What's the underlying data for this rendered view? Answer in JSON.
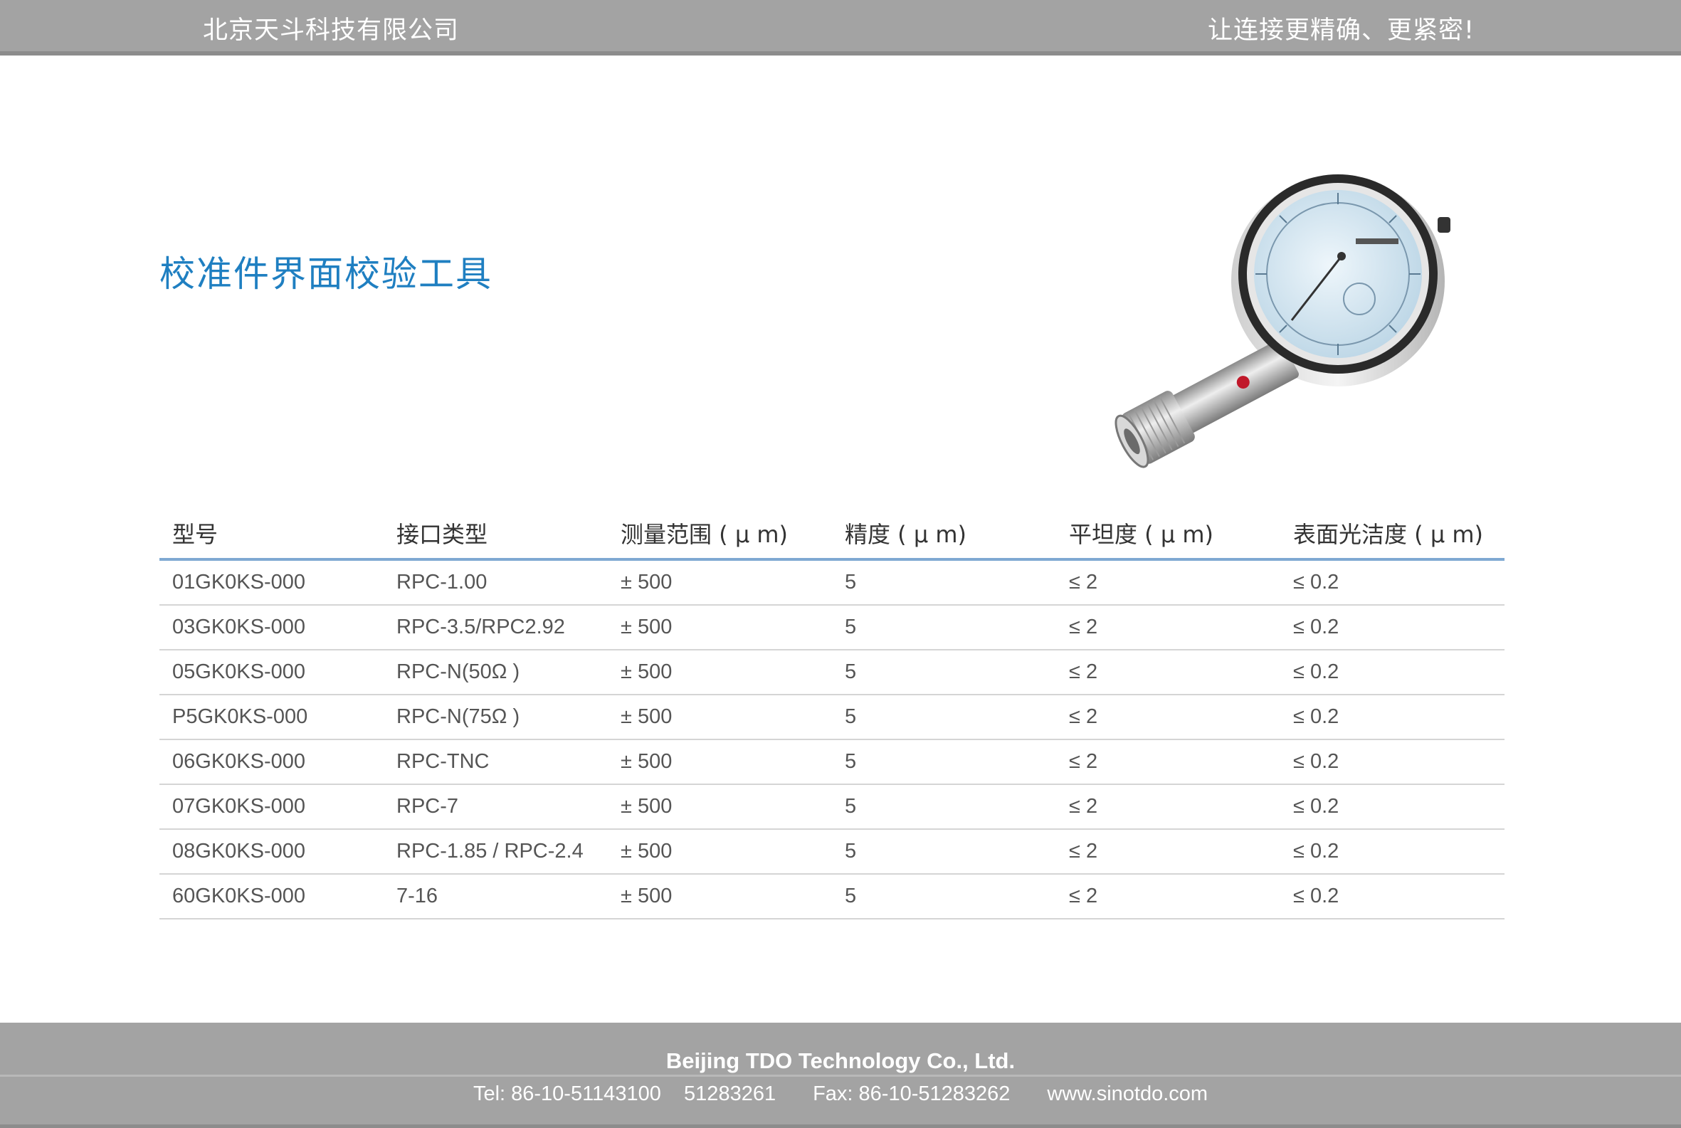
{
  "header": {
    "company": "北京天斗科技有限公司",
    "slogan": "让连接更精确、更紧密!"
  },
  "title": "校准件界面校验工具",
  "table": {
    "headers": [
      "型号",
      "接口类型",
      "测量范围 ( μ m)",
      "精度 ( μ m)",
      "平坦度 ( μ m)",
      "表面光洁度 ( μ m)"
    ],
    "rows": [
      [
        "01GK0KS-000",
        "RPC-1.00",
        "± 500",
        "5",
        "≤ 2",
        "≤ 0.2"
      ],
      [
        "03GK0KS-000",
        "RPC-3.5/RPC2.92",
        "± 500",
        "5",
        "≤ 2",
        "≤ 0.2"
      ],
      [
        "05GK0KS-000",
        "RPC-N(50Ω )",
        "± 500",
        "5",
        "≤ 2",
        "≤ 0.2"
      ],
      [
        "P5GK0KS-000",
        "RPC-N(75Ω )",
        "± 500",
        "5",
        "≤ 2",
        "≤ 0.2"
      ],
      [
        "06GK0KS-000",
        "RPC-TNC",
        "± 500",
        "5",
        "≤ 2",
        "≤ 0.2"
      ],
      [
        "07GK0KS-000",
        "RPC-7",
        "± 500",
        "5",
        "≤ 2",
        "≤ 0.2"
      ],
      [
        "08GK0KS-000",
        "RPC-1.85 / RPC-2.4",
        "± 500",
        "5",
        "≤ 2",
        "≤ 0.2"
      ],
      [
        "60GK0KS-000",
        "7-16",
        "± 500",
        "5",
        "≤ 2",
        "≤ 0.2"
      ]
    ]
  },
  "footer": {
    "company": "Beijing TDO Technology Co., Ltd.",
    "tel": "Tel: 86-10-51143100    51283261",
    "fax": "Fax: 86-10-51283262",
    "web": "www.sinotdo.com"
  },
  "colors": {
    "bar": "#a3a3a3",
    "title": "#1f7fc1",
    "header_rule": "#7fa9d2"
  }
}
